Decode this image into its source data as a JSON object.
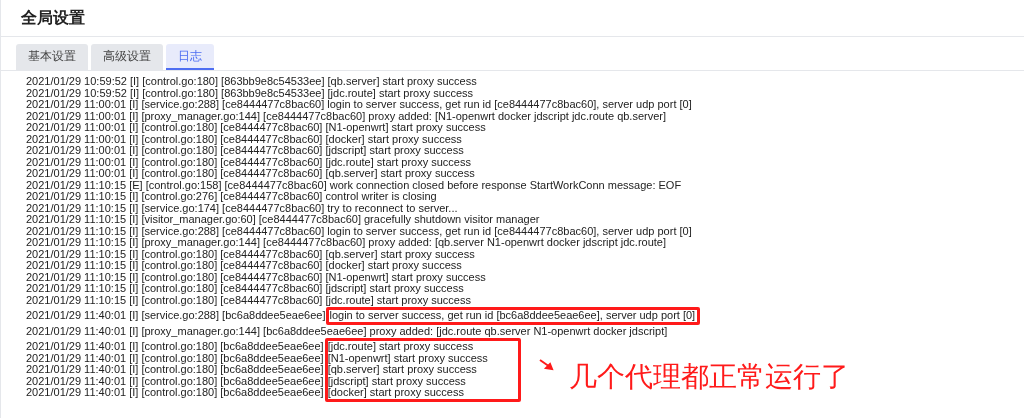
{
  "title": "全局设置",
  "tabs": [
    {
      "label": "基本设置",
      "selected": false
    },
    {
      "label": "高级设置",
      "selected": false
    },
    {
      "label": "日志",
      "selected": true
    }
  ],
  "log": [
    {
      "prefix": "2021/01/29 10:59:52 [I] [control.go:180] [863bb9e8c54533ee]",
      "message": "[qb.server] start proxy success",
      "boxed": false
    },
    {
      "prefix": "2021/01/29 10:59:52 [I] [control.go:180] [863bb9e8c54533ee]",
      "message": "[jdc.route] start proxy success",
      "boxed": false
    },
    {
      "prefix": "2021/01/29 11:00:01 [I] [service.go:288] [ce8444477c8bac60]",
      "message": "login to server success, get run id [ce8444477c8bac60], server udp port [0]",
      "boxed": false
    },
    {
      "prefix": "2021/01/29 11:00:01 [I] [proxy_manager.go:144] [ce8444477c8bac60]",
      "message": "proxy added: [N1-openwrt docker jdscript jdc.route qb.server]",
      "boxed": false
    },
    {
      "prefix": "2021/01/29 11:00:01 [I] [control.go:180] [ce8444477c8bac60]",
      "message": "[N1-openwrt] start proxy success",
      "boxed": false
    },
    {
      "prefix": "2021/01/29 11:00:01 [I] [control.go:180] [ce8444477c8bac60]",
      "message": "[docker] start proxy success",
      "boxed": false
    },
    {
      "prefix": "2021/01/29 11:00:01 [I] [control.go:180] [ce8444477c8bac60]",
      "message": "[jdscript] start proxy success",
      "boxed": false
    },
    {
      "prefix": "2021/01/29 11:00:01 [I] [control.go:180] [ce8444477c8bac60]",
      "message": "[jdc.route] start proxy success",
      "boxed": false
    },
    {
      "prefix": "2021/01/29 11:00:01 [I] [control.go:180] [ce8444477c8bac60]",
      "message": "[qb.server] start proxy success",
      "boxed": false
    },
    {
      "prefix": "2021/01/29 11:10:15 [E] [control.go:158] [ce8444477c8bac60]",
      "message": "work connection closed before response StartWorkConn message: EOF",
      "boxed": false
    },
    {
      "prefix": "2021/01/29 11:10:15 [I] [control.go:276] [ce8444477c8bac60]",
      "message": "control writer is closing",
      "boxed": false
    },
    {
      "prefix": "2021/01/29 11:10:15 [I] [service.go:174] [ce8444477c8bac60]",
      "message": "try to reconnect to server...",
      "boxed": false
    },
    {
      "prefix": "2021/01/29 11:10:15 [I] [visitor_manager.go:60] [ce8444477c8bac60]",
      "message": "gracefully shutdown visitor manager",
      "boxed": false
    },
    {
      "prefix": "2021/01/29 11:10:15 [I] [service.go:288] [ce8444477c8bac60]",
      "message": "login to server success, get run id [ce8444477c8bac60], server udp port [0]",
      "boxed": false
    },
    {
      "prefix": "2021/01/29 11:10:15 [I] [proxy_manager.go:144] [ce8444477c8bac60]",
      "message": "proxy added: [qb.server N1-openwrt docker jdscript jdc.route]",
      "boxed": false
    },
    {
      "prefix": "2021/01/29 11:10:15 [I] [control.go:180] [ce8444477c8bac60]",
      "message": "[qb.server] start proxy success",
      "boxed": false
    },
    {
      "prefix": "2021/01/29 11:10:15 [I] [control.go:180] [ce8444477c8bac60]",
      "message": "[docker] start proxy success",
      "boxed": false
    },
    {
      "prefix": "2021/01/29 11:10:15 [I] [control.go:180] [ce8444477c8bac60]",
      "message": "[N1-openwrt] start proxy success",
      "boxed": false
    },
    {
      "prefix": "2021/01/29 11:10:15 [I] [control.go:180] [ce8444477c8bac60]",
      "message": "[jdscript] start proxy success",
      "boxed": false
    },
    {
      "prefix": "2021/01/29 11:10:15 [I] [control.go:180] [ce8444477c8bac60]",
      "message": "[jdc.route] start proxy success",
      "boxed": false
    },
    {
      "prefix": "2021/01/29 11:40:01 [I] [service.go:288] [bc6a8ddee5eae6ee]",
      "message": "login to server success, get run id [bc6a8ddee5eae6ee], server udp port [0]",
      "boxed": true
    },
    {
      "prefix": "2021/01/29 11:40:01 [I] [proxy_manager.go:144] [bc6a8ddee5eae6ee]",
      "message": "proxy added: [jdc.route qb.server N1-openwrt docker jdscript]",
      "boxed": false
    },
    {
      "prefix": "2021/01/29 11:40:01 [I] [control.go:180] [bc6a8ddee5eae6ee]",
      "message": "[jdc.route] start proxy success",
      "boxed": true
    },
    {
      "prefix": "2021/01/29 11:40:01 [I] [control.go:180] [bc6a8ddee5eae6ee]",
      "message": "[N1-openwrt] start proxy success",
      "boxed": true
    },
    {
      "prefix": "2021/01/29 11:40:01 [I] [control.go:180] [bc6a8ddee5eae6ee]",
      "message": "[qb.server] start proxy success",
      "boxed": true
    },
    {
      "prefix": "2021/01/29 11:40:01 [I] [control.go:180] [bc6a8ddee5eae6ee]",
      "message": "[jdscript] start proxy success",
      "boxed": true
    },
    {
      "prefix": "2021/01/29 11:40:01 [I] [control.go:180] [bc6a8ddee5eae6ee]",
      "message": "[docker] start proxy success",
      "boxed": true
    }
  ],
  "note": "几个代理都正常运行了"
}
